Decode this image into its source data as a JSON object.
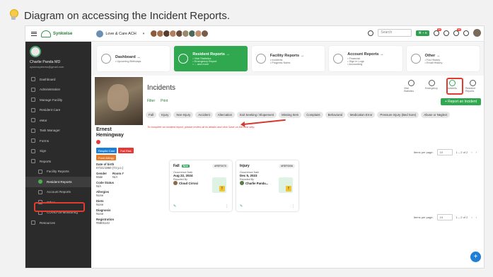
{
  "caption": "Diagram on accessing the Incident Reports.",
  "topbar": {
    "brand": "Synkwise",
    "org": "Love & Care ACH",
    "search_placeholder": "Search",
    "pill": "⌘ + K",
    "badge_a": "99",
    "badge_b": "99"
  },
  "sidebar": {
    "user_name": "Charlie Panda MD",
    "user_email": "sysinosystems@gmail.com",
    "items": [
      {
        "label": "Dashboard"
      },
      {
        "label": "Administration"
      },
      {
        "label": "Manage Facility"
      },
      {
        "label": "Resident Care"
      },
      {
        "label": "eMar"
      },
      {
        "label": "Task Manager"
      },
      {
        "label": "Forms"
      },
      {
        "label": "Sign"
      },
      {
        "label": "Reports"
      },
      {
        "label": "Facility Reports"
      },
      {
        "label": "Resident Reports"
      },
      {
        "label": "Account Reports"
      },
      {
        "label": "Other"
      },
      {
        "label": "COVID-19 Monitoring"
      },
      {
        "label": "Resources"
      }
    ]
  },
  "cards": [
    {
      "title": "Dashboard →",
      "lines": [
        "• Upcoming Birthdays"
      ]
    },
    {
      "title": "Resident Reports →",
      "lines": [
        "• Vital Statistics",
        "• Emergency Report",
        "• ... and more"
      ]
    },
    {
      "title": "Facility Reports →",
      "lines": [
        "• Incidents",
        "• Progress Notes"
      ]
    },
    {
      "title": "Account Reports →",
      "lines": [
        "• Financial",
        "• Sign In Logs",
        "• Accounting"
      ]
    },
    {
      "title": "Other →",
      "lines": [
        "• Fax History",
        "• Email History"
      ]
    }
  ],
  "patient": {
    "first": "Ernest",
    "last": "Hemingway",
    "tags": [
      "Respite Care",
      "Fall Risk",
      "Food Allergy"
    ],
    "dob_label": "Date of birth",
    "dob": "07/21/1950 (74 y.o.)",
    "gender_label": "Gender",
    "gender": "Male",
    "room_label": "Room #",
    "room": "N/A",
    "code_label": "Code Status",
    "code": "N/A",
    "allergies_label": "Allergies",
    "allergies": "None",
    "diets_label": "Diets",
    "diets": "None",
    "diagnosis_label": "Diagnosis",
    "diagnosis": "None",
    "reg_label": "Registration",
    "reg": "#5801143"
  },
  "main": {
    "title": "Incidents",
    "actions": [
      "Vital Statistics",
      "Emergency",
      "Incidents",
      "Resident Reports"
    ],
    "filter": "Filter",
    "print": "Print",
    "add": "+ Report an Incident",
    "chips": [
      "Fall",
      "Injury",
      "Non-Injury",
      "Accident",
      "Altercation",
      "Exit Seeking / Elopement",
      "Missing Item",
      "Complaint",
      "Behavioral",
      "Medication Error",
      "Pressure Injury (Bed Sore)",
      "Abuse or Neglect"
    ],
    "hint": "To complete an incident report, please review all its details and click Save on the final step.",
    "pager_label": "Items per page:",
    "pager_value": "10",
    "pager_range": "1 – 2 of 2",
    "incidents": [
      {
        "type": "Fall",
        "new": "New",
        "id": "#REF0070",
        "date_label": "Occurrence Date",
        "date": "Aug 22, 2024",
        "by_label": "Reported By",
        "by": "Cloud Cirroci"
      },
      {
        "type": "Injury",
        "new": "",
        "id": "#REF0006",
        "date_label": "Occurrence Date",
        "date": "Dec 5, 2023",
        "by_label": "Reported By",
        "by": "Charlie Panda..."
      }
    ]
  },
  "colors": {
    "accent": "#2fa84f",
    "highlight": "#e23b2f",
    "sidebar": "#2b2b2b"
  }
}
